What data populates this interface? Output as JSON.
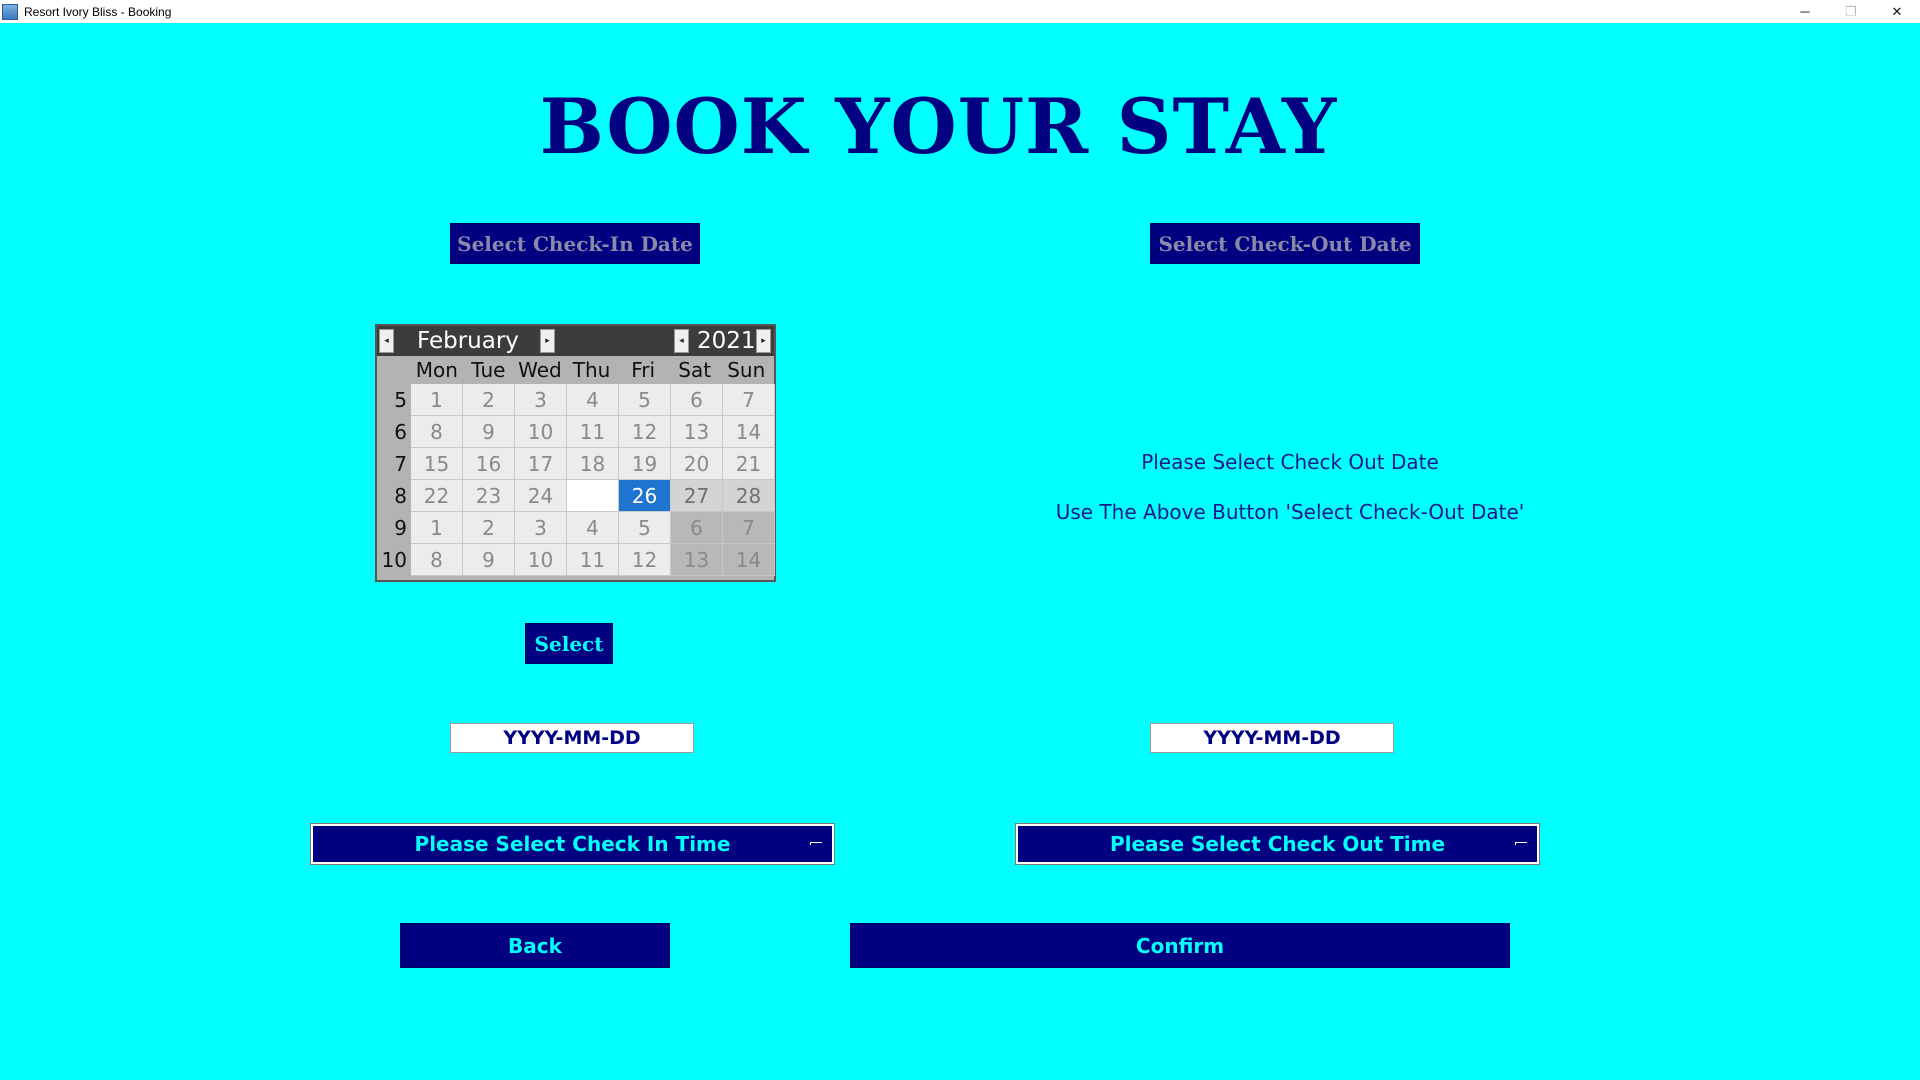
{
  "window": {
    "title": "Resort Ivory Bliss - Booking",
    "controls": [
      "─",
      "❐",
      "✕"
    ]
  },
  "page": {
    "title": "BOOK YOUR STAY"
  },
  "checkin": {
    "button_label": "Select Check-In Date",
    "select_label": "Select",
    "date_value": "YYYY-MM-DD",
    "time_dropdown": "Please Select Check In Time"
  },
  "checkout": {
    "button_label": "Select Check-Out Date",
    "message_line1": "Please Select Check Out Date",
    "message_line2": "Use The Above Button 'Select Check-Out Date'",
    "date_value": "YYYY-MM-DD",
    "time_dropdown": "Please Select Check Out Time"
  },
  "calendar": {
    "month": "February",
    "year": "2021",
    "prev_arrow": "◂",
    "next_arrow": "▸",
    "weekdays": [
      "Mon",
      "Tue",
      "Wed",
      "Thu",
      "Fri",
      "Sat",
      "Sun"
    ],
    "week_numbers": [
      "5",
      "6",
      "7",
      "8",
      "9",
      "10"
    ],
    "weeks": [
      [
        "1",
        "2",
        "3",
        "4",
        "5",
        "6",
        "7"
      ],
      [
        "8",
        "9",
        "10",
        "11",
        "12",
        "13",
        "14"
      ],
      [
        "15",
        "16",
        "17",
        "18",
        "19",
        "20",
        "21"
      ],
      [
        "22",
        "23",
        "24",
        "",
        "26",
        "27",
        "28"
      ],
      [
        "1",
        "2",
        "3",
        "4",
        "5",
        "6",
        "7"
      ],
      [
        "8",
        "9",
        "10",
        "11",
        "12",
        "13",
        "14"
      ]
    ],
    "selected_day": "26",
    "selected_color": "#1e74d0"
  },
  "actions": {
    "back_label": "Back",
    "confirm_label": "Confirm"
  },
  "colors": {
    "background": "#00ffff",
    "navy": "#000080",
    "accent_text": "#00ffff"
  }
}
